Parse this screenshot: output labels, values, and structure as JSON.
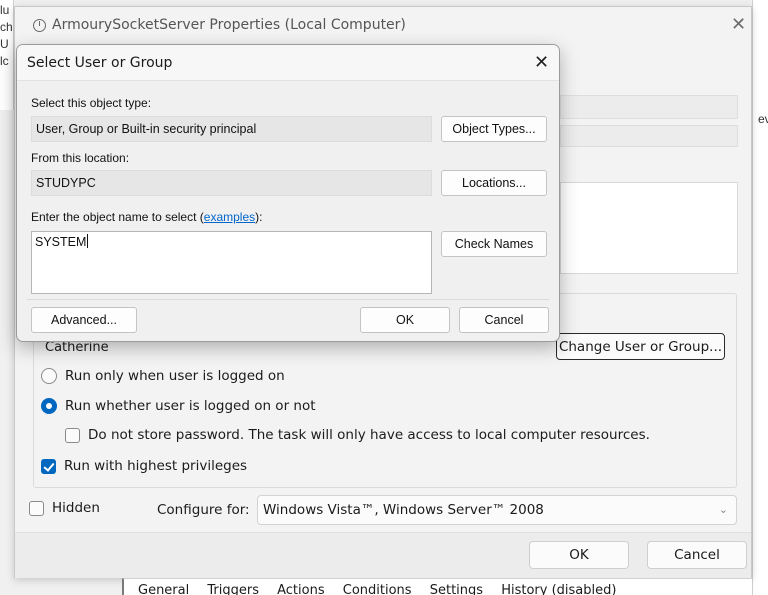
{
  "background": {
    "left_strip_chars": [
      "lu",
      "ch",
      "U",
      "lc"
    ],
    "right_strip_char": "ev",
    "bottom_tabs": [
      "General",
      "Triggers",
      "Actions",
      "Conditions",
      "Settings",
      "History (disabled)"
    ]
  },
  "properties_window": {
    "title": "ArmourySocketServer Properties (Local Computer)",
    "close_glyph": "✕",
    "user_name": "Catherine",
    "change_user_button": "Change User or Group...",
    "radio_logged_on": "Run only when user is logged on",
    "radio_whether": "Run whether user is logged on or not",
    "checkbox_no_store": "Do not store password.  The task will only have access to local computer resources.",
    "checkbox_highest": "Run with highest privileges",
    "checkbox_hidden": "Hidden",
    "configure_label": "Configure for:",
    "configure_value": "Windows Vista™, Windows Server™ 2008",
    "ok_button": "OK",
    "cancel_button": "Cancel"
  },
  "dialog": {
    "title": "Select User or Group",
    "close_glyph": "✕",
    "object_type_label": "Select this object type:",
    "object_type_value": "User, Group or Built-in security principal",
    "object_types_button": "Object Types...",
    "location_label": "From this location:",
    "location_value": "STUDYPC",
    "locations_button": "Locations...",
    "enter_label_prefix": "Enter the object name to select (",
    "enter_label_link": "examples",
    "enter_label_suffix": "):",
    "object_name_value": "SYSTEM",
    "check_names_button": "Check Names",
    "advanced_button": "Advanced...",
    "ok_button": "OK",
    "cancel_button": "Cancel"
  },
  "colors": {
    "accent": "#0067c0",
    "link": "#0066cc"
  }
}
